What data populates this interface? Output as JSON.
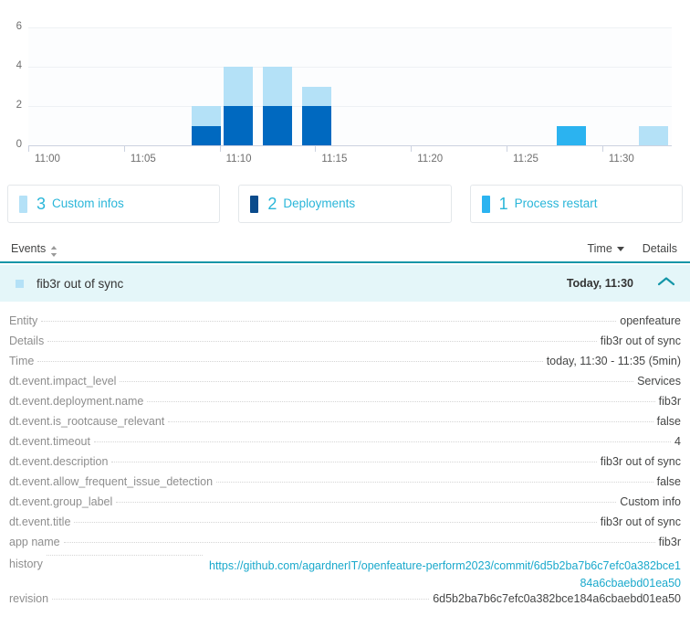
{
  "chart_data": {
    "type": "bar",
    "stacked": true,
    "title": "",
    "xlabel": "",
    "ylabel": "",
    "ylim": [
      0,
      6
    ],
    "yticks": [
      0,
      2,
      4,
      6
    ],
    "xticks": [
      "11:00",
      "11:05",
      "11:10",
      "11:15",
      "11:20",
      "11:25",
      "11:30"
    ],
    "grid": true,
    "series": [
      {
        "name": "Deployments",
        "color": "#0069c0"
      },
      {
        "name": "Custom infos",
        "color": "#b4e1f7"
      },
      {
        "name": "Process restart",
        "color": "#2bb3f0"
      }
    ],
    "bars": [
      {
        "time": "11:08",
        "x": 210,
        "width": 32,
        "segments": [
          {
            "series": "Deployments",
            "value": 1
          },
          {
            "series": "Custom infos",
            "value": 1
          }
        ]
      },
      {
        "time": "11:10",
        "x": 245,
        "width": 32,
        "segments": [
          {
            "series": "Deployments",
            "value": 2
          },
          {
            "series": "Custom infos",
            "value": 2
          }
        ]
      },
      {
        "time": "11:12",
        "x": 288,
        "width": 32,
        "segments": [
          {
            "series": "Deployments",
            "value": 2
          },
          {
            "series": "Custom infos",
            "value": 2
          }
        ]
      },
      {
        "time": "11:15",
        "x": 331,
        "width": 32,
        "segments": [
          {
            "series": "Deployments",
            "value": 2
          },
          {
            "series": "Custom infos",
            "value": 1
          }
        ]
      },
      {
        "time": "11:26",
        "x": 610,
        "width": 32,
        "segments": [
          {
            "series": "Process restart",
            "value": 1
          }
        ]
      },
      {
        "time": "11:31",
        "x": 700,
        "width": 32,
        "segments": [
          {
            "series": "Custom infos",
            "value": 1
          }
        ]
      }
    ]
  },
  "legend": {
    "items": [
      {
        "count": "3",
        "label": "Custom infos",
        "color": "#b4e1f7"
      },
      {
        "count": "2",
        "label": "Deployments",
        "color": "#0a4b8c"
      },
      {
        "count": "1",
        "label": "Process restart",
        "color": "#2bb3f0"
      }
    ]
  },
  "events_table": {
    "header": {
      "events_label": "Events",
      "sort_icon": "sort-updown-icon",
      "time_label": "Time",
      "time_caret": "chevron-down-icon",
      "details_label": "Details"
    },
    "selected_row": {
      "marker_color": "#b4e1f7",
      "title": "fib3r out of sync",
      "time": "Today, 11:30",
      "expand_icon": "chevron-up-icon"
    }
  },
  "details": [
    {
      "key": "Entity",
      "value": "openfeature"
    },
    {
      "key": "Details",
      "value": "fib3r out of sync"
    },
    {
      "key": "Time",
      "value": "today, 11:30 - 11:35 (5min)"
    },
    {
      "key": "dt.event.impact_level",
      "value": "Services"
    },
    {
      "key": "dt.event.deployment.name",
      "value": "fib3r"
    },
    {
      "key": "dt.event.is_rootcause_relevant",
      "value": "false"
    },
    {
      "key": "dt.event.timeout",
      "value": "4"
    },
    {
      "key": "dt.event.description",
      "value": "fib3r out of sync"
    },
    {
      "key": "dt.event.allow_frequent_issue_detection",
      "value": "false"
    },
    {
      "key": "dt.event.group_label",
      "value": "Custom info"
    },
    {
      "key": "dt.event.title",
      "value": "fib3r out of sync"
    },
    {
      "key": "app name",
      "value": "fib3r"
    },
    {
      "key": "history",
      "value": "https://github.com/agardnerIT/openfeature-perform2023/commit/6d5b2ba7b6c7efc0a382bce184a6cbaebd01ea50",
      "is_link": true
    },
    {
      "key": "revision",
      "value": "6d5b2ba7b6c7efc0a382bce184a6cbaebd01ea50"
    }
  ]
}
